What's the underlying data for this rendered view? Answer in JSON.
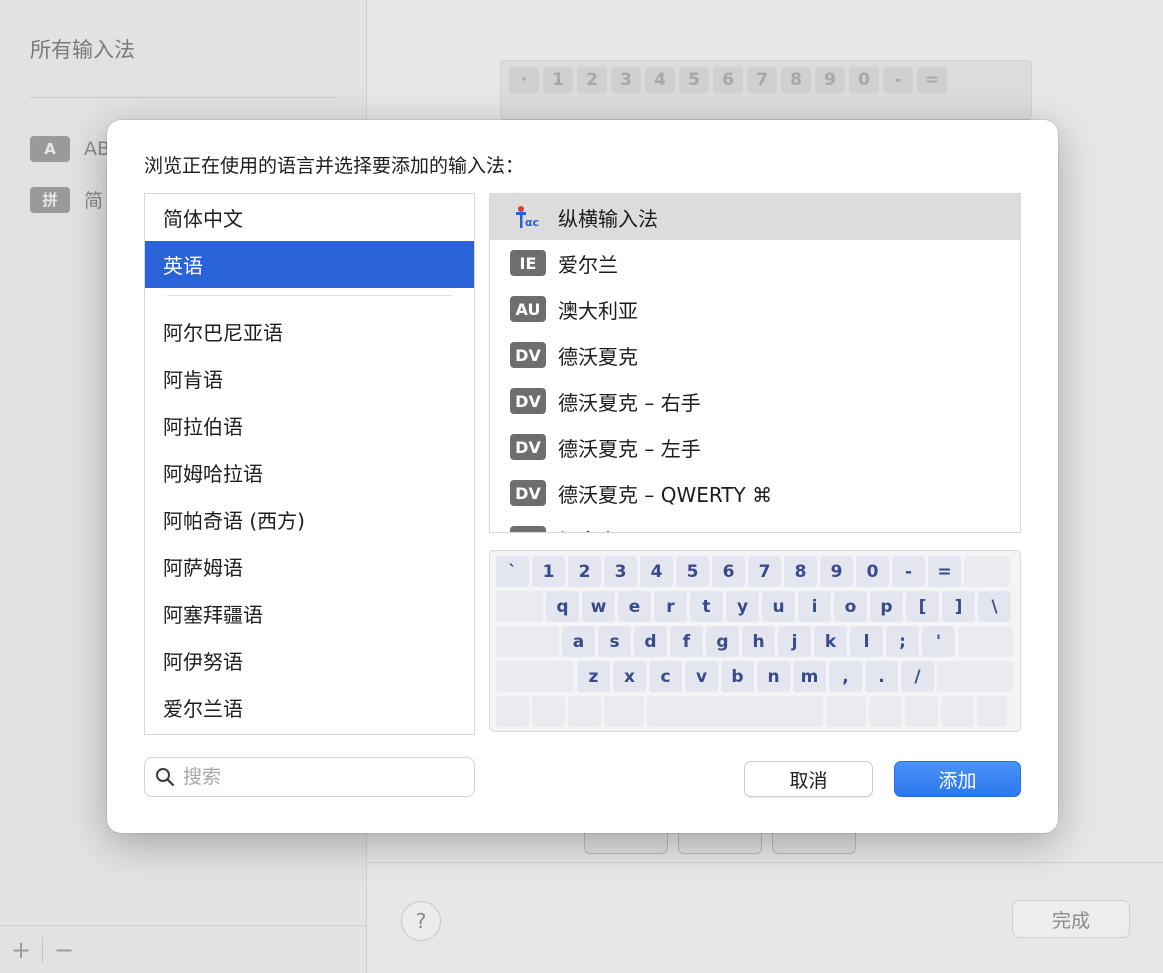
{
  "background": {
    "sidebar_title": "所有输入法",
    "sidebar_items": [
      {
        "badge": "A",
        "label": "AB"
      },
      {
        "badge": "拼",
        "label": "简"
      }
    ],
    "add_symbol": "+",
    "remove_symbol": "−",
    "help_symbol": "?",
    "done_label": "完成",
    "keyboard_top": [
      "·",
      "1",
      "2",
      "3",
      "4",
      "5",
      "6",
      "7",
      "8",
      "9",
      "0",
      "-",
      "="
    ]
  },
  "dialog": {
    "prompt": "浏览正在使用的语言并选择要添加的输入法：",
    "languages_top": [
      {
        "label": "简体中文"
      },
      {
        "label": "英语"
      }
    ],
    "languages": [
      {
        "label": "阿尔巴尼亚语"
      },
      {
        "label": "阿肯语"
      },
      {
        "label": "阿拉伯语"
      },
      {
        "label": "阿姆哈拉语"
      },
      {
        "label": "阿帕奇语 (西方)"
      },
      {
        "label": "阿萨姆语"
      },
      {
        "label": "阿塞拜疆语"
      },
      {
        "label": "阿伊努语"
      },
      {
        "label": "爱尔兰语"
      }
    ],
    "selected_language": "英语",
    "input_methods": [
      {
        "badge": "",
        "icon": "zongheng-logo-icon",
        "label": "纵横输入法"
      },
      {
        "badge": "IE",
        "label": "爱尔兰"
      },
      {
        "badge": "AU",
        "label": "澳大利亚"
      },
      {
        "badge": "DV",
        "label": "德沃夏克"
      },
      {
        "badge": "DV",
        "label": "德沃夏克 – 右手"
      },
      {
        "badge": "DV",
        "label": "德沃夏克 – 左手"
      },
      {
        "badge": "DV",
        "label": "德沃夏克 – QWERTY ⌘"
      },
      {
        "badge": "CA",
        "label": "加拿大"
      }
    ],
    "keyboard": {
      "row1": [
        "`",
        "1",
        "2",
        "3",
        "4",
        "5",
        "6",
        "7",
        "8",
        "9",
        "0",
        "-",
        "="
      ],
      "row2": [
        "q",
        "w",
        "e",
        "r",
        "t",
        "y",
        "u",
        "i",
        "o",
        "p",
        "[",
        "]",
        "\\"
      ],
      "row3": [
        "a",
        "s",
        "d",
        "f",
        "g",
        "h",
        "j",
        "k",
        "l",
        ";",
        "'"
      ],
      "row4": [
        "z",
        "x",
        "c",
        "v",
        "b",
        "n",
        "m",
        ",",
        ".",
        "/"
      ]
    },
    "search_placeholder": "搜索",
    "cancel_label": "取消",
    "add_label": "添加"
  },
  "colors": {
    "selection_blue": "#2962d9",
    "primary_button": "#2b77ef",
    "key_text": "#3b4a8c"
  }
}
